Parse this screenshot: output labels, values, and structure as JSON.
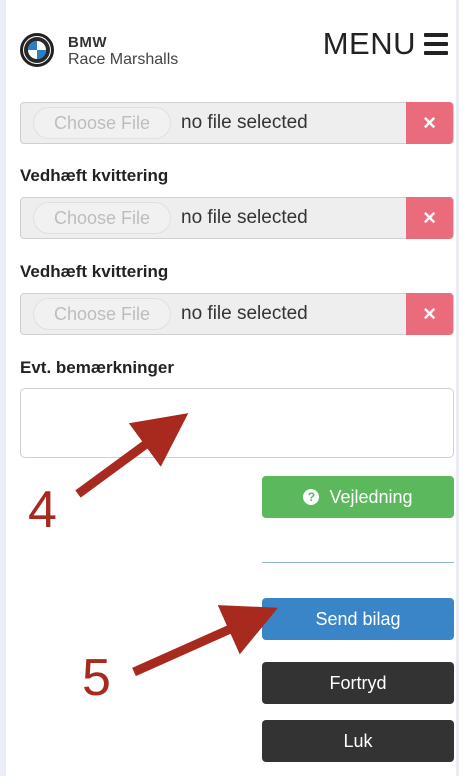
{
  "header": {
    "brand_line1": "BMW",
    "brand_line2": "Race Marshalls",
    "menu_label": "MENU"
  },
  "form": {
    "attachments": [
      {
        "choose_label": "Choose File",
        "status": "no file selected"
      },
      {
        "label": "Vedhæft kvittering",
        "choose_label": "Choose File",
        "status": "no file selected"
      },
      {
        "label": "Vedhæft kvittering",
        "choose_label": "Choose File",
        "status": "no file selected"
      }
    ],
    "remove_icon": "×",
    "remarks_label": "Evt. bemærkninger",
    "remarks_value": ""
  },
  "actions": {
    "help_label": "Vejledning",
    "help_icon": "?",
    "submit_label": "Send bilag",
    "cancel_label": "Fortryd",
    "close_label": "Luk"
  },
  "annotations": {
    "num4": "4",
    "num5": "5"
  },
  "colors": {
    "remove": "#e96b7c",
    "help": "#5cb85c",
    "submit": "#3a85c8",
    "dark": "#333333",
    "annotation": "#a82a1e"
  }
}
